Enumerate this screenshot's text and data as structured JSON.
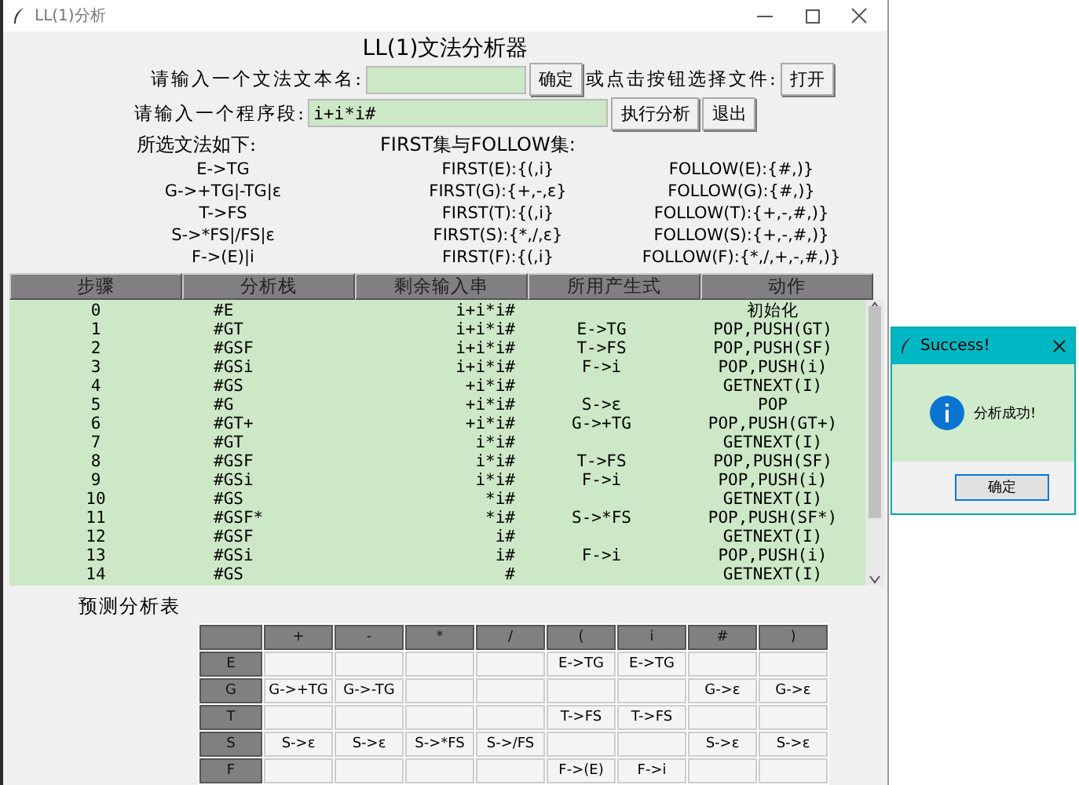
{
  "window": {
    "title": "LL(1)分析"
  },
  "heading": "LL(1)文法分析器",
  "grammar_file": {
    "label": "请输入一个文法文本名:",
    "confirm_button": "确定",
    "choose_label": "或点击按钮选择文件:",
    "open_button": "打开"
  },
  "program": {
    "label": "请输入一个程序段:",
    "value": "i+i*i#",
    "run_button": "执行分析",
    "exit_button": "退出"
  },
  "grammar_title": "所选文法如下:",
  "sets_title": "FIRST集与FOLLOW集:",
  "grammar": [
    {
      "production": "E->TG",
      "first": "FIRST(E):{(,i}",
      "follow": "FOLLOW(E):{#,)}"
    },
    {
      "production": "G->+TG|-TG|ε",
      "first": "FIRST(G):{+,-,ε}",
      "follow": "FOLLOW(G):{#,)}"
    },
    {
      "production": "T->FS",
      "first": "FIRST(T):{(,i}",
      "follow": "FOLLOW(T):{+,-,#,)}"
    },
    {
      "production": "S->*FS|/FS|ε",
      "first": "FIRST(S):{*,/,ε}",
      "follow": "FOLLOW(S):{+,-,#,)}"
    },
    {
      "production": "F->(E)|i",
      "first": "FIRST(F):{(,i}",
      "follow": "FOLLOW(F):{*,/,+,-,#,)}"
    }
  ],
  "steps": {
    "columns": [
      "步骤",
      "分析栈",
      "剩余输入串",
      "所用产生式",
      "动作"
    ],
    "rows": [
      [
        "0",
        "#E",
        "i+i*i#",
        "",
        "初始化"
      ],
      [
        "1",
        "#GT",
        "i+i*i#",
        "E->TG",
        "POP,PUSH(GT)"
      ],
      [
        "2",
        "#GSF",
        "i+i*i#",
        "T->FS",
        "POP,PUSH(SF)"
      ],
      [
        "3",
        "#GSi",
        "i+i*i#",
        "F->i",
        "POP,PUSH(i)"
      ],
      [
        "4",
        "#GS",
        "+i*i#",
        "",
        "GETNEXT(I)"
      ],
      [
        "5",
        "#G",
        "+i*i#",
        "S->ε",
        "POP"
      ],
      [
        "6",
        "#GT+",
        "+i*i#",
        "G->+TG",
        "POP,PUSH(GT+)"
      ],
      [
        "7",
        "#GT",
        "i*i#",
        "",
        "GETNEXT(I)"
      ],
      [
        "8",
        "#GSF",
        "i*i#",
        "T->FS",
        "POP,PUSH(SF)"
      ],
      [
        "9",
        "#GSi",
        "i*i#",
        "F->i",
        "POP,PUSH(i)"
      ],
      [
        "10",
        "#GS",
        "*i#",
        "",
        "GETNEXT(I)"
      ],
      [
        "11",
        "#GSF*",
        "*i#",
        "S->*FS",
        "POP,PUSH(SF*)"
      ],
      [
        "12",
        "#GSF",
        "i#",
        "",
        "GETNEXT(I)"
      ],
      [
        "13",
        "#GSi",
        "i#",
        "F->i",
        "POP,PUSH(i)"
      ],
      [
        "14",
        "#GS",
        "#",
        "",
        "GETNEXT(I)"
      ]
    ]
  },
  "predict_table": {
    "title": "预测分析表",
    "columns": [
      "+",
      "-",
      "*",
      "/",
      "(",
      "i",
      "#",
      ")"
    ],
    "rows": [
      {
        "symbol": "E",
        "cells": [
          "",
          "",
          "",
          "",
          "E->TG",
          "E->TG",
          "",
          ""
        ]
      },
      {
        "symbol": "G",
        "cells": [
          "G->+TG",
          "G->-TG",
          "",
          "",
          "",
          "",
          "G->ε",
          "G->ε"
        ]
      },
      {
        "symbol": "T",
        "cells": [
          "",
          "",
          "",
          "",
          "T->FS",
          "T->FS",
          "",
          ""
        ]
      },
      {
        "symbol": "S",
        "cells": [
          "S->ε",
          "S->ε",
          "S->*FS",
          "S->/FS",
          "",
          "",
          "S->ε",
          "S->ε"
        ]
      },
      {
        "symbol": "F",
        "cells": [
          "",
          "",
          "",
          "",
          "F->(E)",
          "F->i",
          "",
          ""
        ]
      }
    ]
  },
  "dialog": {
    "title": "Success!",
    "message": "分析成功!",
    "ok_button": "确定"
  }
}
